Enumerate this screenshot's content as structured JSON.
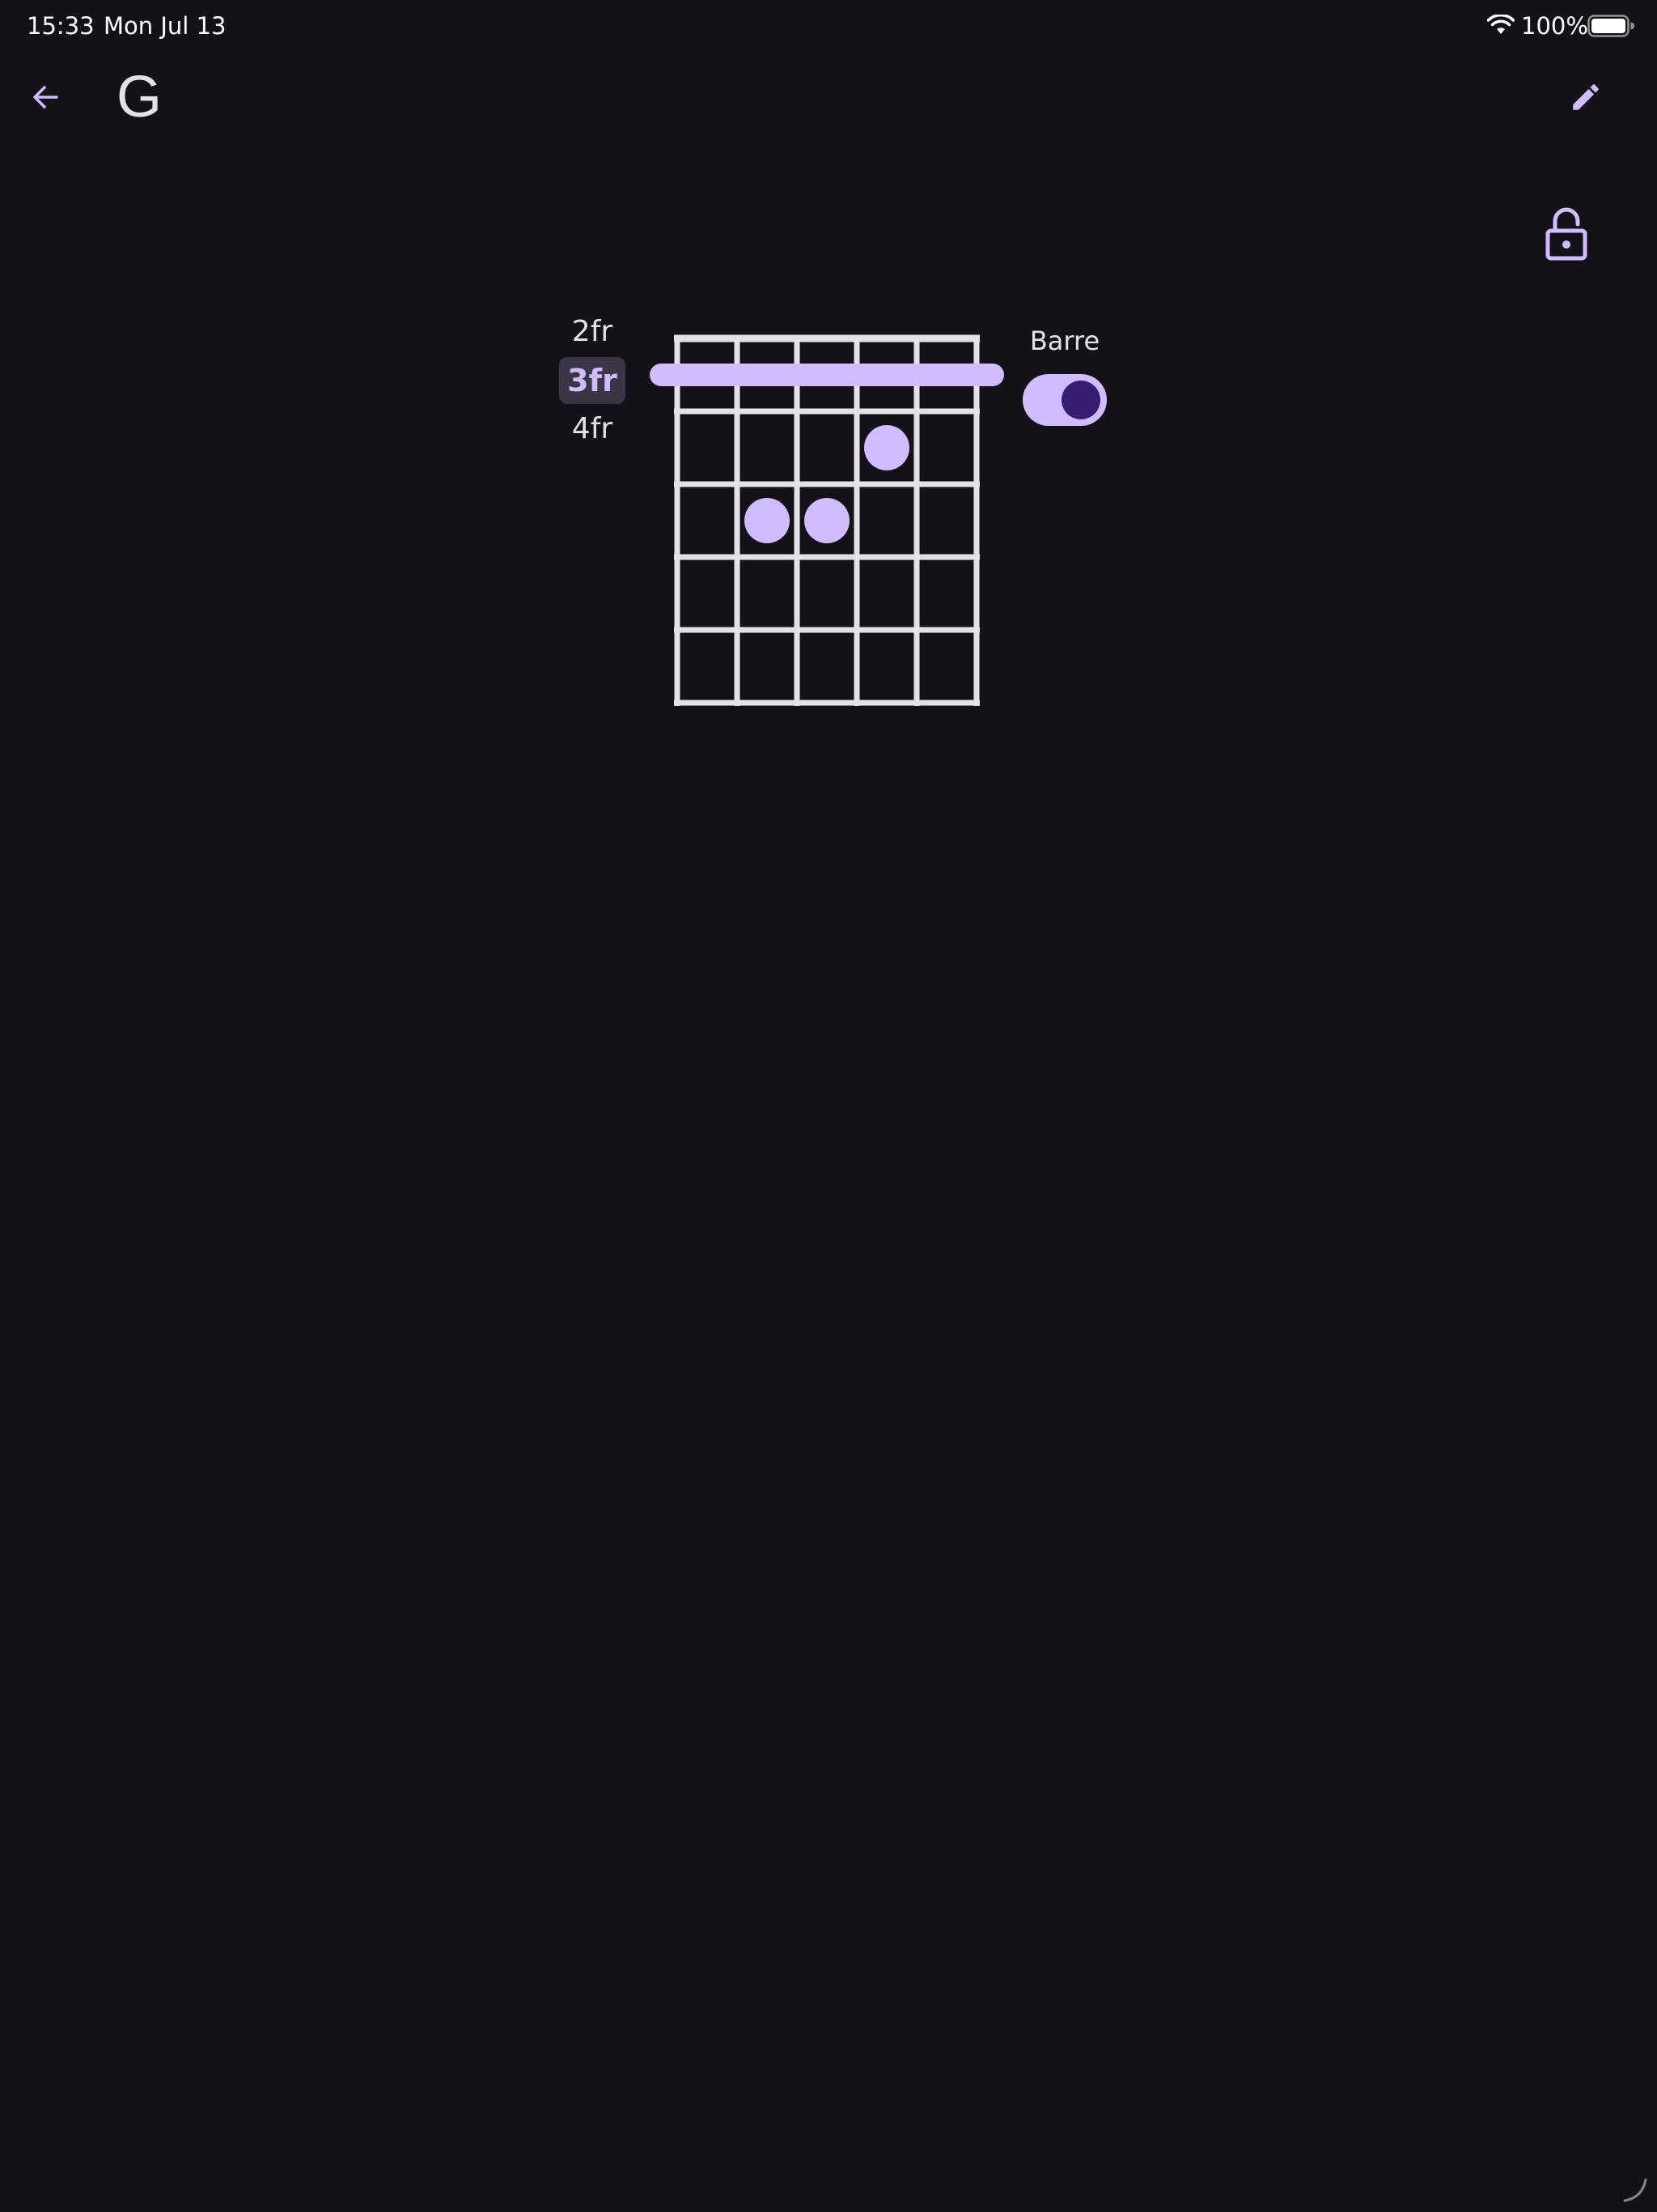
{
  "status_bar": {
    "time": "15:33",
    "date": "Mon Jul 13",
    "battery_percent": "100%",
    "wifi_icon": "wifi-icon",
    "battery_icon": "battery-icon",
    "battery_level": 1.0
  },
  "app_bar": {
    "title": "G",
    "back_icon": "arrow-back-icon",
    "edit_icon": "pencil-icon"
  },
  "lock_icon": "lock-open-icon",
  "fret_selector": {
    "options": [
      "2fr",
      "3fr",
      "4fr"
    ],
    "selected": "3fr"
  },
  "chord": {
    "strings": 6,
    "frets_shown": 5,
    "barre_fret": 1,
    "fingers": [
      {
        "string": 4,
        "fret": 2
      },
      {
        "string": 2,
        "fret": 3
      },
      {
        "string": 3,
        "fret": 3
      }
    ]
  },
  "barre": {
    "label": "Barre",
    "enabled": true
  },
  "colors": {
    "background": "#141218",
    "accent": "#d0bcff",
    "on_accent": "#381e72",
    "grid": "#e6e0e9",
    "selected_chip": "#3b3546"
  }
}
